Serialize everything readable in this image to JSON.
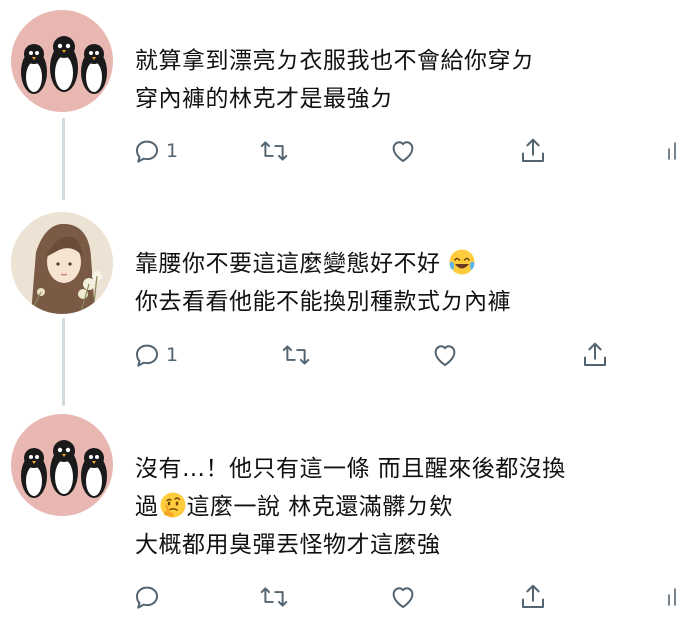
{
  "tweets": [
    {
      "avatar": "penguin-avatar",
      "lines": [
        "就算拿到漂亮ㄉ衣服我也不會給你穿ㄉ",
        "穿內褲的林克才是最強ㄉ"
      ],
      "reply_count": "1"
    },
    {
      "avatar": "girl-illustration-avatar",
      "lines": [
        "靠腰你不要這這麼變態好不好",
        "你去看看他能不能換別種款式ㄉ內褲"
      ],
      "emoji": "joy-emoji",
      "reply_count": "1"
    },
    {
      "avatar": "penguin-avatar",
      "lines": [
        "沒有…！他只有這一條 而且醒來後都沒換",
        "這麼一說 林克還滿髒ㄉ欸",
        "大概都用臭彈丟怪物才這麼強"
      ],
      "line2_prefix": "過",
      "emoji": "thinking-emoji",
      "reply_count": ""
    }
  ],
  "icons": {
    "reply": "reply-icon",
    "retweet": "retweet-icon",
    "like": "heart-icon",
    "share": "share-icon",
    "analytics": "analytics-icon"
  },
  "colors": {
    "icon": "#536471",
    "thread_line": "#cfd9de",
    "avatar_bg_pink": "#e8b7b2"
  }
}
